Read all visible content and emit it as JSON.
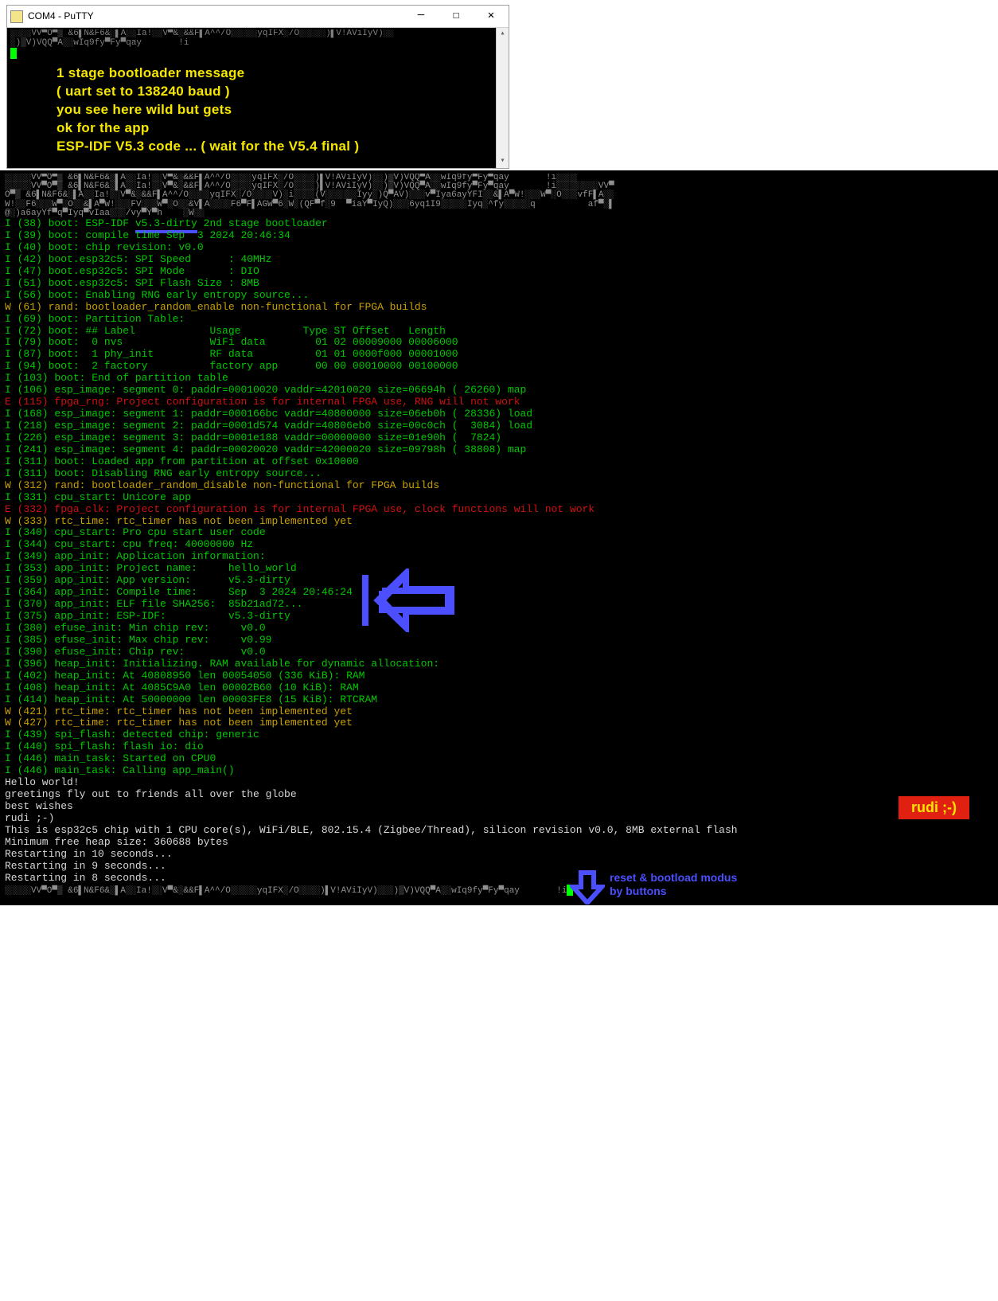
{
  "putty": {
    "title": "COM4 - PuTTY",
    "garbled": "░░░░VV▀O▀▒ &6▌N&F6&░▌A░░Ia!░░V▀&░&&F▌A^^/O░░░░░yqIFX░/O░░░░░)▌V!AViIyV)░░\n░)▒V)VQQ▀A░░wIq9fy▀Fy▀qay       !i",
    "annotation": [
      "1 stage bootloader message",
      "( uart set to 138240 baud )",
      "you see here wild but gets",
      "ok for the app",
      "ESP-IDF V5.3 code ... ( wait for the V5.4 final )"
    ]
  },
  "garbled_main": "░░░░░VV▀O▀▒ &6▌N&F6&░▌A░░Ia!░░V▀&░&&F▌A^^/O░░░░yqIFX░/O░░░░)▌V!AViIyV)░░)▒V)VQQ▀A░░wIq9fy▀Fy▀qay       !i░░░░\n░░░░░VV▀O▀▒ &6▌N&F6&░▌A░░Ia!░░V▀&░&&F▌A^^/O░░░░yqIFX░/O░░░░)▌V!AViIyV)░░)▒V)VQQ▀A░░wIq9fy▀Fy▀qay       !i░░░░░░░░VV▀\nO▀▒ &6▌N&F6&░▌A░░Ia!░░V▀&░&&F▌A^^/O░░░░yqIFX░/O░░░░V)░i░░░░(V░░░░░░Iyy░)Q▀AV)░░░v▀Iya6ayYFI░░&▌A▀W!░░░W▀░O░░░vfF▌A░░\nW!░░F6░░░W▀░O░░&▌A▀W!░░░FV░░░W▀░O░░&V▌A░░░░F6▀F▌AGW▀6░W░(QF▀f░9  ▀iaY▀IyQ)░░░6yq1I9░░░░░Iyq░^fy░░░░░q          af▀░▌\n@░)a6ayYf▀q▀Iyq▀vIaa░░░/vy▀Y▀h    ░W░░",
  "boot_header_pre": "I (38) boot: ESP-IDF ",
  "boot_header_v": "v5.3-dirty",
  "boot_header_post": " 2nd stage bootloader",
  "log_lines": [
    {
      "lv": "I",
      "t": "(39) boot: compile time Sep  3 2024 20:46:34"
    },
    {
      "lv": "I",
      "t": "(40) boot: chip revision: v0.0"
    },
    {
      "lv": "I",
      "t": "(42) boot.esp32c5: SPI Speed      : 40MHz"
    },
    {
      "lv": "I",
      "t": "(47) boot.esp32c5: SPI Mode       : DIO"
    },
    {
      "lv": "I",
      "t": "(51) boot.esp32c5: SPI Flash Size : 8MB"
    },
    {
      "lv": "I",
      "t": "(56) boot: Enabling RNG early entropy source..."
    },
    {
      "lv": "W",
      "t": "(61) rand: bootloader_random_enable non-functional for FPGA builds"
    },
    {
      "lv": "I",
      "t": "(69) boot: Partition Table:"
    },
    {
      "lv": "I",
      "t": "(72) boot: ## Label            Usage          Type ST Offset   Length"
    },
    {
      "lv": "I",
      "t": "(79) boot:  0 nvs              WiFi data        01 02 00009000 00006000"
    },
    {
      "lv": "I",
      "t": "(87) boot:  1 phy_init         RF data          01 01 0000f000 00001000"
    },
    {
      "lv": "I",
      "t": "(94) boot:  2 factory          factory app      00 00 00010000 00100000"
    },
    {
      "lv": "I",
      "t": "(103) boot: End of partition table"
    },
    {
      "lv": "I",
      "t": "(106) esp_image: segment 0: paddr=00010020 vaddr=42010020 size=06694h ( 26260) map"
    },
    {
      "lv": "E",
      "t": "(115) fpga_rng: Project configuration is for internal FPGA use, RNG will not work"
    },
    {
      "lv": "I",
      "t": "(168) esp_image: segment 1: paddr=000166bc vaddr=40800000 size=06eb0h ( 28336) load"
    },
    {
      "lv": "I",
      "t": "(218) esp_image: segment 2: paddr=0001d574 vaddr=40806eb0 size=00c0ch (  3084) load"
    },
    {
      "lv": "I",
      "t": "(226) esp_image: segment 3: paddr=0001e188 vaddr=00000000 size=01e90h (  7824)"
    },
    {
      "lv": "I",
      "t": "(241) esp_image: segment 4: paddr=00020020 vaddr=42000020 size=09798h ( 38808) map"
    },
    {
      "lv": "I",
      "t": "(311) boot: Loaded app from partition at offset 0x10000"
    },
    {
      "lv": "I",
      "t": "(311) boot: Disabling RNG early entropy source..."
    },
    {
      "lv": "W",
      "t": "(312) rand: bootloader_random_disable non-functional for FPGA builds"
    },
    {
      "lv": "I",
      "t": "(331) cpu_start: Unicore app"
    },
    {
      "lv": "E",
      "t": "(332) fpga_clk: Project configuration is for internal FPGA use, clock functions will not work"
    },
    {
      "lv": "W",
      "t": "(333) rtc_time: rtc_timer has not been implemented yet"
    },
    {
      "lv": "I",
      "t": "(340) cpu_start: Pro cpu start user code"
    },
    {
      "lv": "I",
      "t": "(344) cpu_start: cpu freq: 40000000 Hz"
    },
    {
      "lv": "I",
      "t": "(349) app_init: Application information:"
    },
    {
      "lv": "I",
      "t": "(353) app_init: Project name:     hello_world"
    },
    {
      "lv": "I",
      "t": "(359) app_init: App version:      v5.3-dirty"
    },
    {
      "lv": "I",
      "t": "(364) app_init: Compile time:     Sep  3 2024 20:46:24"
    },
    {
      "lv": "I",
      "t": "(370) app_init: ELF file SHA256:  85b21ad72..."
    },
    {
      "lv": "I",
      "t": "(375) app_init: ESP-IDF:          v5.3-dirty"
    },
    {
      "lv": "I",
      "t": "(380) efuse_init: Min chip rev:     v0.0"
    },
    {
      "lv": "I",
      "t": "(385) efuse_init: Max chip rev:     v0.99"
    },
    {
      "lv": "I",
      "t": "(390) efuse_init: Chip rev:         v0.0"
    },
    {
      "lv": "I",
      "t": "(396) heap_init: Initializing. RAM available for dynamic allocation:"
    },
    {
      "lv": "I",
      "t": "(402) heap_init: At 40808950 len 00054050 (336 KiB): RAM"
    },
    {
      "lv": "I",
      "t": "(408) heap_init: At 4085C9A0 len 00002B60 (10 KiB): RAM"
    },
    {
      "lv": "I",
      "t": "(414) heap_init: At 50000000 len 00003FE8 (15 KiB): RTCRAM"
    },
    {
      "lv": "W",
      "t": "(421) rtc_time: rtc_timer has not been implemented yet"
    },
    {
      "lv": "W",
      "t": "(427) rtc_time: rtc_timer has not been implemented yet"
    },
    {
      "lv": "I",
      "t": "(439) spi_flash: detected chip: generic"
    },
    {
      "lv": "I",
      "t": "(440) spi_flash: flash io: dio"
    },
    {
      "lv": "I",
      "t": "(446) main_task: Started on CPU0"
    },
    {
      "lv": "I",
      "t": "(446) main_task: Calling app_main()"
    }
  ],
  "plain_lines": [
    "Hello world!",
    "greetings fly out to friends all over the globe",
    "best wishes",
    "rudi ;-)",
    "This is esp32c5 chip with 1 CPU core(s), WiFi/BLE, 802.15.4 (Zigbee/Thread), silicon revision v0.0, 8MB external flash",
    "Minimum free heap size: 360688 bytes",
    "Restarting in 10 seconds...",
    "Restarting in 9 seconds...",
    "Restarting in 8 seconds..."
  ],
  "garbled_bottom": "░░░░░VV▀O▀▒ &6▌N&F6&░▌A░░Ia!░░V▀&░&&F▌A^^/O░░░░░yqIFX░/O░░░░)▌V!AViIyV)░░░)▒V)VQQ▀A░░wIq9fy▀Fy▀qay       !i",
  "rudi_badge": "rudi ;-)",
  "reset_anno": [
    "reset & bootload modus",
    "by buttons"
  ]
}
